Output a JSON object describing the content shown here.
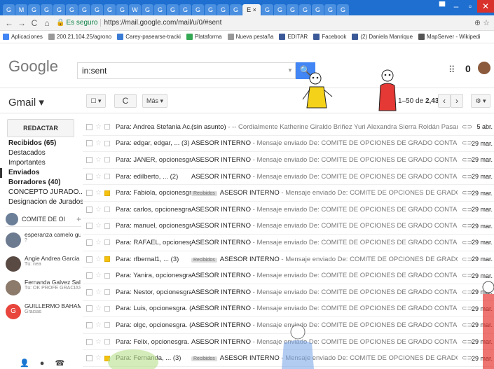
{
  "browser": {
    "tabs": [
      "G",
      "M",
      "G",
      "G",
      "G",
      "G",
      "G",
      "G",
      "G",
      "G",
      "W",
      "G",
      "G",
      "G",
      "G",
      "G",
      "G",
      "G",
      "G",
      "E ×",
      "G",
      "G",
      "G",
      "G",
      "G",
      "G",
      "G"
    ],
    "active_tab_label": "E ×",
    "back": "←",
    "forward": "→",
    "reload": "C",
    "home": "⌂",
    "secure_label": "Es seguro",
    "url": "https://mail.google.com/mail/u/0/#sent",
    "addr_icons": "⊕ ☆",
    "window_controls": [
      "▀",
      "–",
      "▫",
      "✕"
    ]
  },
  "bookmarks": [
    {
      "label": "Aplicaciones",
      "color": "#4285f4"
    },
    {
      "label": "200.21.104.25/agrono",
      "color": "#999999"
    },
    {
      "label": "Carey-pasearse-tracki",
      "color": "#3a7bd5"
    },
    {
      "label": "Plataforma",
      "color": "#34a853"
    },
    {
      "label": "Nueva pestaña",
      "color": "#999999"
    },
    {
      "label": "EDITAR",
      "color": "#3b5998"
    },
    {
      "label": "Facebook",
      "color": "#3b5998"
    },
    {
      "label": "(2) Daniela Manrique",
      "color": "#3b5998"
    },
    {
      "label": "MapServer - Wikipedi",
      "color": "#555555"
    }
  ],
  "header": {
    "logo": "Google",
    "search_value": "in:sent",
    "search_icon": "search-icon",
    "apps_icon": "⠿"
  },
  "toolbar": {
    "app_label": "Gmail ▾",
    "select_label": "☐ ▾",
    "refresh_label": "C",
    "more_label": "Más ▾",
    "pager_prefix": "1–50 de",
    "pager_total": "2,433",
    "prev": "‹",
    "next": "›",
    "settings": "⚙ ▾"
  },
  "sidebar": {
    "compose": "REDACTAR",
    "items": [
      {
        "label": "Recibidos (65)",
        "style": "bold"
      },
      {
        "label": "Destacados",
        "style": ""
      },
      {
        "label": "Importantes",
        "style": ""
      },
      {
        "label": "Enviados",
        "style": "selected"
      },
      {
        "label": "Borradores (40)",
        "style": "bold"
      },
      {
        "label": "CONCEPTO JURADO...",
        "style": "",
        "color": "#e53935"
      },
      {
        "label": "Designacion de Jurados",
        "style": "",
        "color": "#43a047"
      }
    ],
    "hangouts_user": "COMITE DE OI",
    "hangouts_plus": "+",
    "contacts": [
      {
        "name": "esperanza camelo gu",
        "sub": "?",
        "color": "#6d7b91"
      },
      {
        "name": "Angie Andrea Garcia",
        "sub": "Tú: nea",
        "color": "#5a4a44"
      },
      {
        "name": "Fernanda Galvez Sal",
        "sub": "Tú: OK PROFE GRACIAS",
        "color": "#8c7a6b"
      },
      {
        "name": "GUILLERMO BAHAM",
        "sub": "Gracias",
        "color": "#e8453c",
        "initial": "G"
      }
    ],
    "bottom_icons": "👤 ● ☎"
  },
  "mails": [
    {
      "to": "Para: Andrea Stefania Ac.",
      "subject": "(sin asunto)",
      "snippet": " - -- Cordialmente Katherine Giraldo Briñez Yuri Alexandra Sierra Roldán Pasantes de Contaduría Publica Comité de O",
      "tag": "",
      "imp": false,
      "date": "5 abr."
    },
    {
      "to": "Para: edgar, edgar, ... (3)",
      "subject": "ASESOR INTERNO",
      "snippet": " - Mensaje enviado De: COMITE DE OPCIONES DE GRADO CONTADURIA <cogcontaduria@gmail.com> F",
      "tag": "",
      "imp": false,
      "date": "29 mar."
    },
    {
      "to": "Para: JANER, opcionesgra. (5)",
      "subject": "ASESOR INTERNO",
      "snippet": " - Mensaje enviado De: COMITE DE OPCIONES DE GRADO CONTADURIA <cogcontaduria@gmail.com> F",
      "tag": "",
      "imp": false,
      "date": "29 mar."
    },
    {
      "to": "Para: edilberto, ... (2)",
      "subject": "ASESOR INTERNO",
      "snippet": " - Mensaje enviado De: COMITE DE OPCIONES DE GRADO CONTADURIA <cogcontaduria@gmail.com> F",
      "tag": "",
      "imp": false,
      "date": "29 mar."
    },
    {
      "to": "Para: Fabiola, opcionesgra. (3)",
      "subject": "ASESOR INTERNO",
      "snippet": " - Mensaje enviado De: COMITE DE OPCIONES DE GRADO CONTADURIA <cogcontaduria@gm",
      "tag": "Recibidos",
      "imp": true,
      "date": "29 mar."
    },
    {
      "to": "Para: carlos, opcionesgra. (2)",
      "subject": "ASESOR INTERNO",
      "snippet": " - Mensaje enviado De: COMITE DE OPCIONES DE GRADO CONTADURIA <cogcontaduria@gmail.com> F",
      "tag": "",
      "imp": false,
      "date": "29 mar."
    },
    {
      "to": "Para: manuel, opcionesgra. (2)",
      "subject": "ASESOR INTERNO",
      "snippet": " - Mensaje enviado De: COMITE DE OPCIONES DE GRADO CONTADURIA <cogcontaduria@gmail.com> F",
      "tag": "",
      "imp": false,
      "date": "29 mar."
    },
    {
      "to": "Para: RAFAEL, opcionesgra. (2)",
      "subject": "ASESOR INTERNO",
      "snippet": " - Mensaje enviado De: COMITE DE OPCIONES DE GRADO CONTADURIA <cogcontaduria@gmail.com> F",
      "tag": "",
      "imp": false,
      "date": "29 mar."
    },
    {
      "to": "Para: rfbernal1, ... (3)",
      "subject": "ASESOR INTERNO",
      "snippet": " - Mensaje enviado De: COMITE DE OPCIONES DE GRADO CONTADURIA <cogcontaduria@gm",
      "tag": "Recibidos",
      "imp": true,
      "date": "29 mar."
    },
    {
      "to": "Para: Yanira, opcionesgra. (2)",
      "subject": "ASESOR INTERNO",
      "snippet": " - Mensaje enviado De: COMITE DE OPCIONES DE GRADO CONTADURIA <cogcontaduria@gmail.com> F",
      "tag": "",
      "imp": false,
      "date": "29 mar."
    },
    {
      "to": "Para: Nestor, opcionesgra. (2)",
      "subject": "ASESOR INTERNO",
      "snippet": " - Mensaje enviado De: COMITE DE OPCIONES DE GRADO CONTADURIA <cogcontaduria@gmail.com> F",
      "tag": "",
      "imp": false,
      "date": "29 mar."
    },
    {
      "to": "Para: Luis, opcionesgra. (2)",
      "subject": "ASESOR INTERNO",
      "snippet": " - Mensaje enviado De: COMITE DE OPCIONES DE GRADO CONTADURIA <cogcontaduria@gmail.com> F",
      "tag": "",
      "imp": false,
      "date": "29 mar."
    },
    {
      "to": "Para: olgc, opcionesgra. (2)",
      "subject": "ASESOR INTERNO",
      "snippet": " - Mensaje enviado De: COMITE DE OPCIONES DE GRADO CONTADURIA <cogcontaduria@gmail.com> F",
      "tag": "",
      "imp": false,
      "date": "29 mar."
    },
    {
      "to": "Para: Felix, opcionesgra. (2)",
      "subject": "ASESOR INTERNO",
      "snippet": " - Mensaje enviado De: COMITE DE OPCIONES DE GRADO CONTADURIA <cogcontaduria@gmail.com> F",
      "tag": "",
      "imp": false,
      "date": "29 mar."
    },
    {
      "to": "Para: Fernanda, ... (3)",
      "subject": "ASESOR INTERNO",
      "snippet": " - Mensaje enviado De: COMITE DE OPCIONES DE GRADO CONTADURIA <cogcontaduria@gm",
      "tag": "Recibidos",
      "imp": true,
      "date": "29 mar."
    }
  ],
  "colors": {
    "tabstrip": "#1e6fd0",
    "search_button": "#4285f4",
    "important": "#f4c20d"
  }
}
